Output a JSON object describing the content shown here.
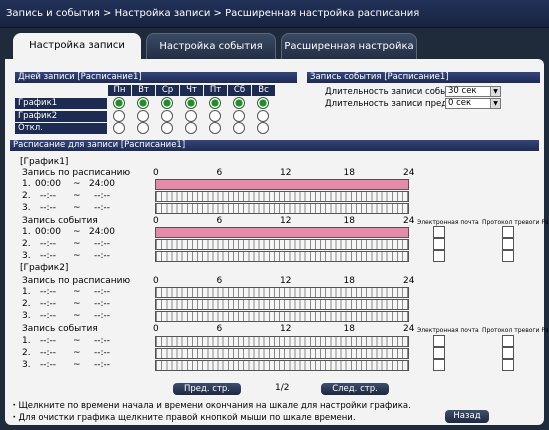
{
  "breadcrumb": "Запись и события > Настройка записи > Расширенная настройка расписания",
  "tabs": [
    "Настройка записи",
    "Настройка события",
    "Расширенная настройка"
  ],
  "days_section": {
    "title": "Дней записи [Расписание1]",
    "days": [
      "Пн",
      "Вт",
      "Ср",
      "Чт",
      "Пт",
      "Сб",
      "Вс"
    ],
    "rows": [
      {
        "label": "График1",
        "selected": [
          true,
          true,
          true,
          true,
          true,
          true,
          true
        ]
      },
      {
        "label": "График2",
        "selected": [
          false,
          false,
          false,
          false,
          false,
          false,
          false
        ]
      },
      {
        "label": "Откл.",
        "selected": [
          false,
          false,
          false,
          false,
          false,
          false,
          false
        ]
      }
    ]
  },
  "event_section": {
    "title": "Запись события [Расписание1]",
    "duration_label": "Длительность записи события",
    "duration_value": "30 сек",
    "pre_label": "Длительность записи пред-события",
    "pre_value": "0 сек"
  },
  "schedule_title": "Расписание для записи [Расписание1]",
  "axis_ticks": [
    "0",
    "6",
    "12",
    "18",
    "24"
  ],
  "dash": "~",
  "email_label": "Электронная почта",
  "alarm_label": "Протокол тревоги Panasonic",
  "graphs": [
    {
      "title": "[График1]",
      "schedule_label": "Запись по расписанию",
      "schedule_rows": [
        {
          "num": "1.",
          "start": "00:00",
          "end": "24:00",
          "fill": [
            0,
            24
          ]
        },
        {
          "num": "2.",
          "start": "--:--",
          "end": "--:--"
        },
        {
          "num": "3.",
          "start": "--:--",
          "end": "--:--"
        }
      ],
      "event_label": "Запись события",
      "event_rows": [
        {
          "num": "1.",
          "start": "00:00",
          "end": "24:00",
          "fill": [
            0,
            24
          ]
        },
        {
          "num": "2.",
          "start": "--:--",
          "end": "--:--"
        },
        {
          "num": "3.",
          "start": "--:--",
          "end": "--:--"
        }
      ]
    },
    {
      "title": "[График2]",
      "schedule_label": "Запись по расписанию",
      "schedule_rows": [
        {
          "num": "1.",
          "start": "--:--",
          "end": "--:--"
        },
        {
          "num": "2.",
          "start": "--:--",
          "end": "--:--"
        },
        {
          "num": "3.",
          "start": "--:--",
          "end": "--:--"
        }
      ],
      "event_label": "Запись события",
      "event_rows": [
        {
          "num": "1.",
          "start": "--:--",
          "end": "--:--"
        },
        {
          "num": "2.",
          "start": "--:--",
          "end": "--:--"
        },
        {
          "num": "3.",
          "start": "--:--",
          "end": "--:--"
        }
      ]
    }
  ],
  "pager": {
    "prev": "Пред. стр.",
    "page": "1/2",
    "next": "След. стр."
  },
  "notes": [
    "・Щелкните по времени начала и времени окончания на шкале для настройки графика.",
    "・Для очистки графика щелкните правой кнопкой мыши по шкале времени."
  ],
  "back_label": "Назад"
}
